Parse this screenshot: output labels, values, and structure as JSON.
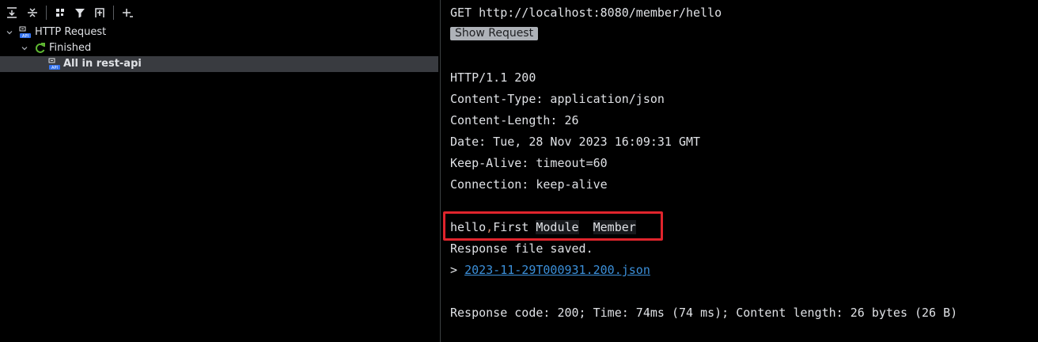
{
  "tree": {
    "root_label": "HTTP Request",
    "status_label": "Finished",
    "item_label": "All in rest-api"
  },
  "response": {
    "request_line": "GET http://localhost:8080/member/hello",
    "show_request_label": "Show Request",
    "status_line": "HTTP/1.1 200",
    "headers": [
      "Content-Type: application/json",
      "Content-Length: 26",
      "Date: Tue, 28 Nov 2023 16:09:31 GMT",
      "Keep-Alive: timeout=60",
      "Connection: keep-alive"
    ],
    "body_part1": "hello",
    "body_comma": ",",
    "body_part2": "First",
    "body_part3": "Module",
    "body_part4": "Member",
    "saved_message": "Response file saved.",
    "file_prefix": "> ",
    "file_link": "2023-11-29T000931.200.json",
    "summary": "Response code: 200; Time: 74ms (74 ms); Content length: 26 bytes (26 B)"
  },
  "colors": {
    "highlight_box": "#e0242c",
    "link": "#3b8fd9",
    "selected_row": "#393b40",
    "status_icon": "#5fb832"
  }
}
